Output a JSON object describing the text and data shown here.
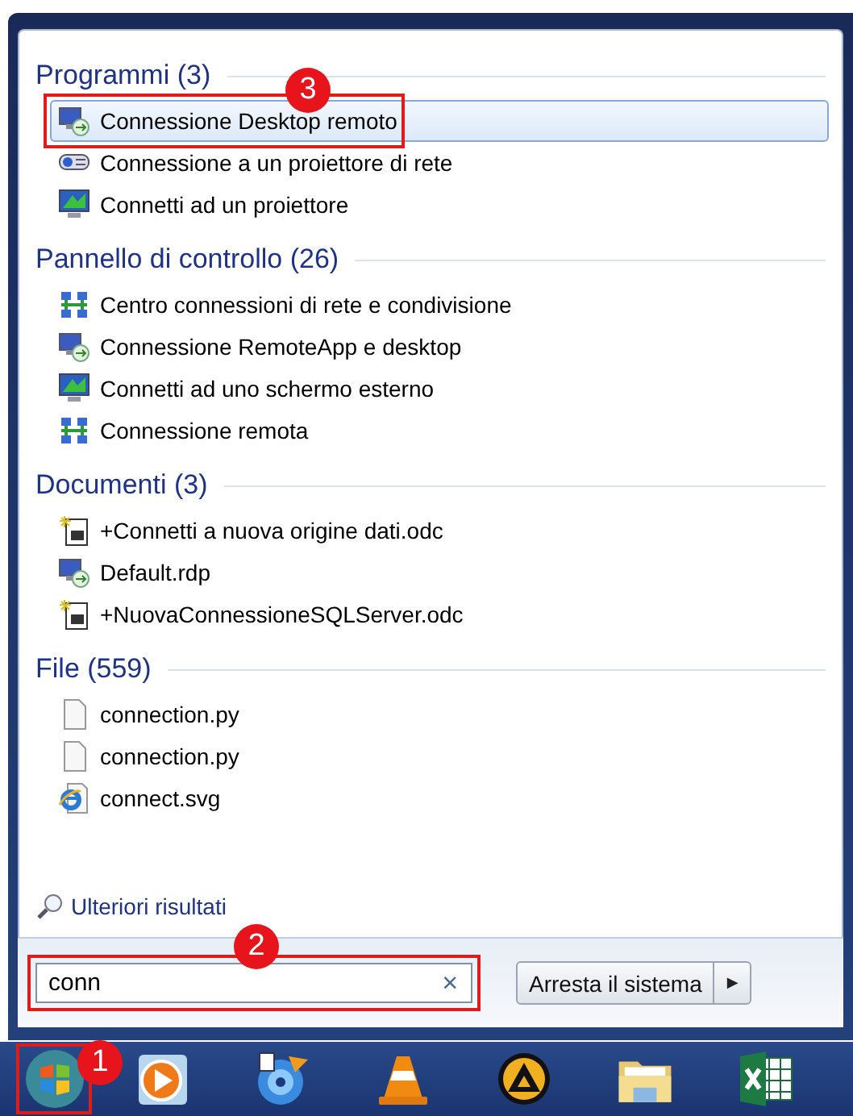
{
  "sections": [
    {
      "title": "Programmi (3)",
      "items": [
        {
          "label": "Connessione Desktop remoto",
          "kind": "remote-desktop",
          "selected": true,
          "callout": "3"
        },
        {
          "label": "Connessione a un proiettore di rete",
          "kind": "network-projector",
          "selected": false
        },
        {
          "label": "Connetti ad un proiettore",
          "kind": "monitor",
          "selected": false
        }
      ]
    },
    {
      "title": "Pannello di controllo (26)",
      "items": [
        {
          "label": "Centro connessioni di rete e condivisione",
          "kind": "network",
          "selected": false
        },
        {
          "label": "Connessione RemoteApp e desktop",
          "kind": "remote-desktop",
          "selected": false
        },
        {
          "label": "Connetti ad uno schermo esterno",
          "kind": "monitor",
          "selected": false
        },
        {
          "label": "Connessione remota",
          "kind": "network",
          "selected": false
        }
      ]
    },
    {
      "title": "Documenti (3)",
      "items": [
        {
          "label": "+Connetti a nuova origine dati.odc",
          "kind": "data-file",
          "selected": false
        },
        {
          "label": "Default.rdp",
          "kind": "remote-desktop",
          "selected": false
        },
        {
          "label": "+NuovaConnessioneSQLServer.odc",
          "kind": "data-file",
          "selected": false
        }
      ]
    },
    {
      "title": "File (559)",
      "items": [
        {
          "label": "connection.py",
          "kind": "blank-file",
          "selected": false
        },
        {
          "label": "connection.py",
          "kind": "blank-file",
          "selected": false
        },
        {
          "label": "connect.svg",
          "kind": "web-file",
          "selected": false
        }
      ]
    }
  ],
  "more_results": "Ulteriori risultati",
  "search": {
    "value": "conn",
    "clear": "×",
    "callout": "2"
  },
  "shutdown": {
    "label": "Arresta il sistema",
    "arrow": "▶"
  },
  "taskbar": {
    "start_callout": "1",
    "apps": [
      {
        "kind": "media-player"
      },
      {
        "kind": "disc-burner"
      },
      {
        "kind": "cone"
      },
      {
        "kind": "round-player"
      },
      {
        "kind": "folder"
      },
      {
        "kind": "spreadsheet"
      }
    ]
  }
}
